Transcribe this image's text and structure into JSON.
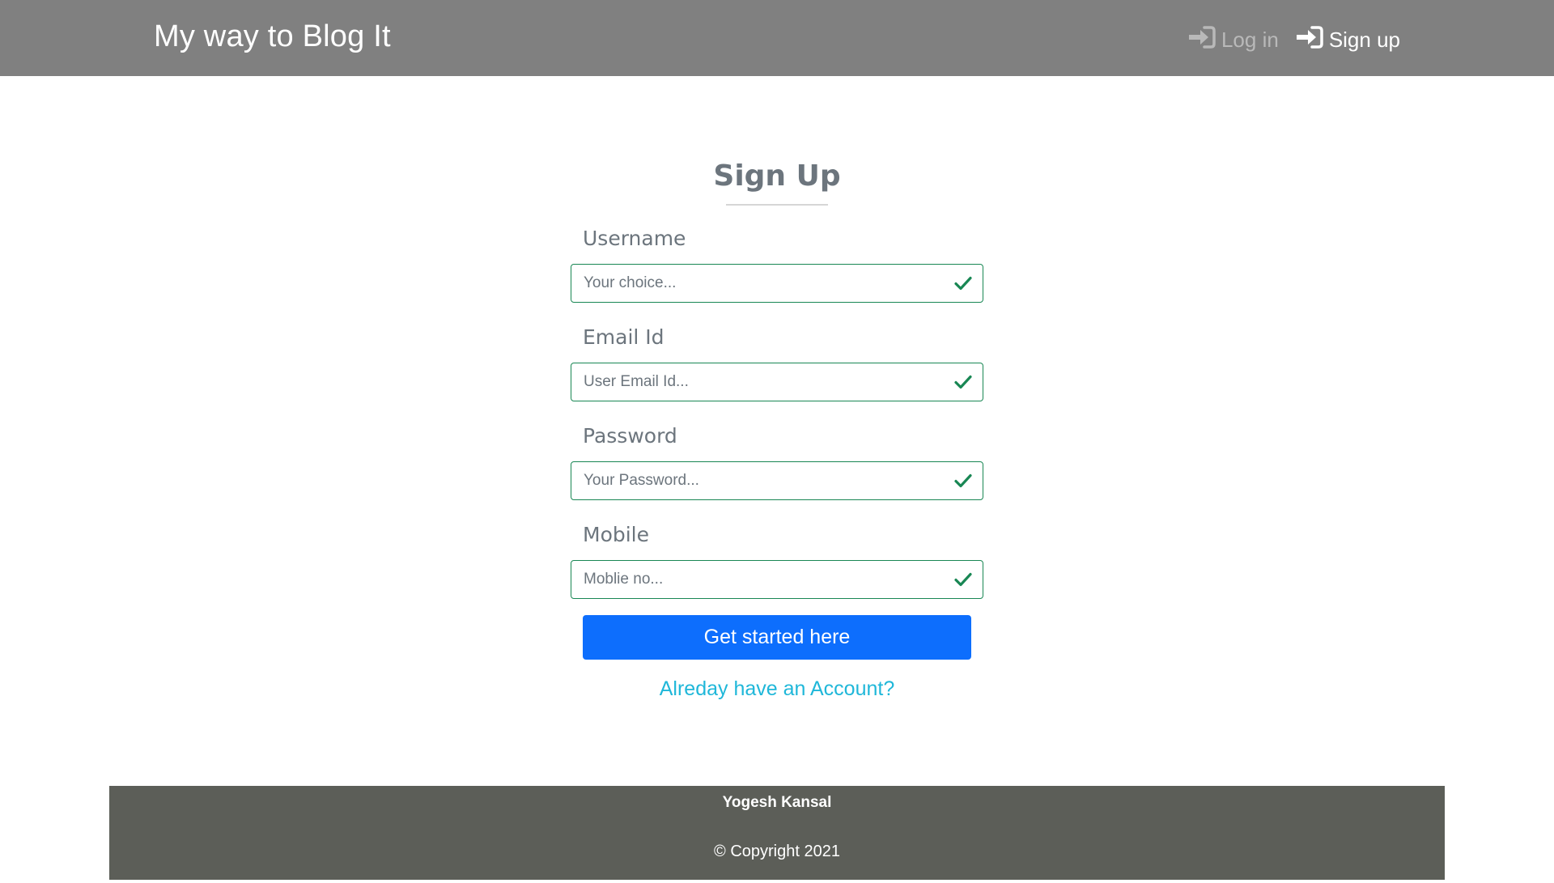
{
  "navbar": {
    "brand": "My way to Blog It",
    "login_label": "Log in",
    "signup_label": "Sign up",
    "login_icon": "sign-in-icon",
    "signup_icon": "sign-in-icon",
    "background_color": "#808080"
  },
  "form": {
    "title": "Sign Up",
    "fields": [
      {
        "label": "Username",
        "placeholder": "Your choice...",
        "value": ""
      },
      {
        "label": "Email Id",
        "placeholder": "User Email Id...",
        "value": ""
      },
      {
        "label": "Password",
        "placeholder": "Your Password...",
        "value": ""
      },
      {
        "label": "Mobile",
        "placeholder": "Moblie no...",
        "value": ""
      }
    ],
    "valid_icon": "check-icon",
    "valid_color": "#198754",
    "submit_label": "Get started here",
    "submit_color": "#0d6efd",
    "account_link": "Alreday have an Account?",
    "link_color": "#1fb7d9"
  },
  "footer": {
    "name": "Yogesh Kansal",
    "copyright": "© Copyright 2021",
    "background_color": "#5c5e58"
  }
}
